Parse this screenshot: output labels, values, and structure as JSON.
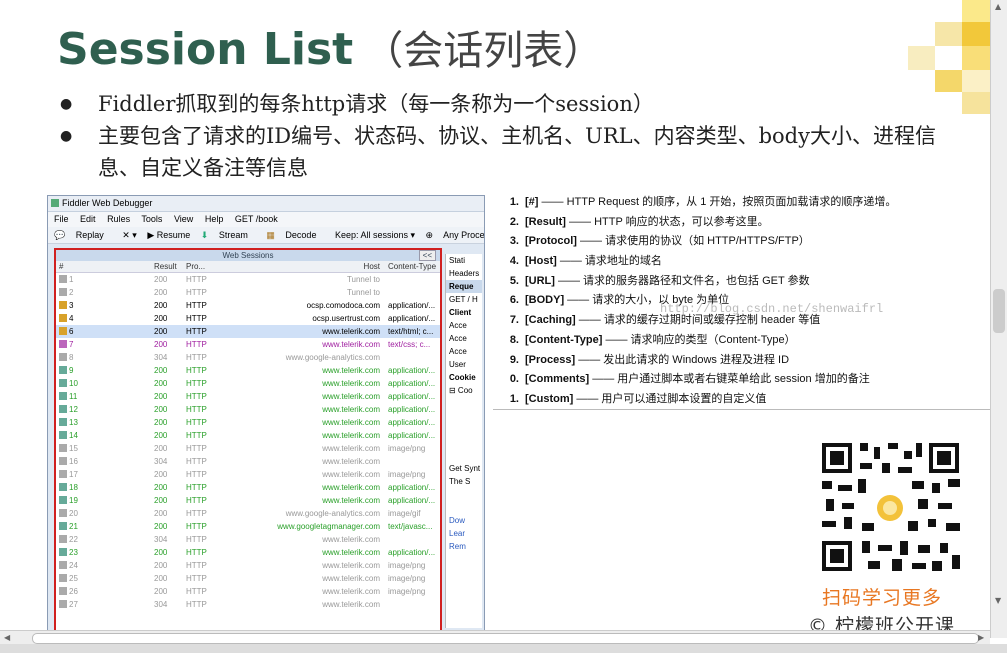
{
  "title": {
    "main": "Session List",
    "cn": "（会话列表）"
  },
  "bullets": [
    "Fiddler抓取到的每条http请求（每一条称为一个session）",
    "主要包含了请求的ID编号、状态码、协议、主机名、URL、内容类型、body大小、进程信息、自定义备注等信息"
  ],
  "fiddler": {
    "window_title": "Fiddler Web Debugger",
    "menu": [
      "File",
      "Edit",
      "Rules",
      "Tools",
      "View",
      "Help",
      "GET /book"
    ],
    "toolbar": [
      "Replay",
      "✕ ▾",
      "▶ Resume",
      "Stream",
      "Decode",
      "Keep: All sessions ▾",
      "Any Process"
    ],
    "panel_title": "Web Sessions",
    "collapse_label": "<<",
    "columns": {
      "num": "#",
      "result": "Result",
      "protocol": "Pro...",
      "host": "Host",
      "content_type": "Content-Type"
    },
    "rows": [
      {
        "num": "1",
        "result": "200",
        "protocol": "HTTP",
        "host": "Tunnel to",
        "ct": "",
        "color": "gr"
      },
      {
        "num": "2",
        "result": "200",
        "protocol": "HTTP",
        "host": "Tunnel to",
        "ct": "",
        "color": "gr"
      },
      {
        "num": "3",
        "result": "200",
        "protocol": "HTTP",
        "host": "ocsp.comodoca.com",
        "ct": "application/...",
        "color": "bk"
      },
      {
        "num": "4",
        "result": "200",
        "protocol": "HTTP",
        "host": "ocsp.usertrust.com",
        "ct": "application/...",
        "color": "bk"
      },
      {
        "num": "6",
        "result": "200",
        "protocol": "HTTP",
        "host": "www.telerik.com",
        "ct": "text/html; c...",
        "color": "bk"
      },
      {
        "num": "7",
        "result": "200",
        "protocol": "HTTP",
        "host": "www.telerik.com",
        "ct": "text/css; c...",
        "color": "p"
      },
      {
        "num": "8",
        "result": "304",
        "protocol": "HTTP",
        "host": "www.google-analytics.com",
        "ct": "",
        "color": "gr"
      },
      {
        "num": "9",
        "result": "200",
        "protocol": "HTTP",
        "host": "www.telerik.com",
        "ct": "application/...",
        "color": "g"
      },
      {
        "num": "10",
        "result": "200",
        "protocol": "HTTP",
        "host": "www.telerik.com",
        "ct": "application/...",
        "color": "g"
      },
      {
        "num": "11",
        "result": "200",
        "protocol": "HTTP",
        "host": "www.telerik.com",
        "ct": "application/...",
        "color": "g"
      },
      {
        "num": "12",
        "result": "200",
        "protocol": "HTTP",
        "host": "www.telerik.com",
        "ct": "application/...",
        "color": "g"
      },
      {
        "num": "13",
        "result": "200",
        "protocol": "HTTP",
        "host": "www.telerik.com",
        "ct": "application/...",
        "color": "g"
      },
      {
        "num": "14",
        "result": "200",
        "protocol": "HTTP",
        "host": "www.telerik.com",
        "ct": "application/...",
        "color": "g"
      },
      {
        "num": "15",
        "result": "200",
        "protocol": "HTTP",
        "host": "www.telerik.com",
        "ct": "image/png",
        "color": "gr"
      },
      {
        "num": "16",
        "result": "304",
        "protocol": "HTTP",
        "host": "www.telerik.com",
        "ct": "",
        "color": "gr"
      },
      {
        "num": "17",
        "result": "200",
        "protocol": "HTTP",
        "host": "www.telerik.com",
        "ct": "image/png",
        "color": "gr"
      },
      {
        "num": "18",
        "result": "200",
        "protocol": "HTTP",
        "host": "www.telerik.com",
        "ct": "application/...",
        "color": "g"
      },
      {
        "num": "19",
        "result": "200",
        "protocol": "HTTP",
        "host": "www.telerik.com",
        "ct": "application/...",
        "color": "g"
      },
      {
        "num": "20",
        "result": "200",
        "protocol": "HTTP",
        "host": "www.google-analytics.com",
        "ct": "image/gif",
        "color": "gr"
      },
      {
        "num": "21",
        "result": "200",
        "protocol": "HTTP",
        "host": "www.googletagmanager.com",
        "ct": "text/javasc...",
        "color": "g"
      },
      {
        "num": "22",
        "result": "304",
        "protocol": "HTTP",
        "host": "www.telerik.com",
        "ct": "",
        "color": "gr"
      },
      {
        "num": "23",
        "result": "200",
        "protocol": "HTTP",
        "host": "www.telerik.com",
        "ct": "application/...",
        "color": "g"
      },
      {
        "num": "24",
        "result": "200",
        "protocol": "HTTP",
        "host": "www.telerik.com",
        "ct": "image/png",
        "color": "gr"
      },
      {
        "num": "25",
        "result": "200",
        "protocol": "HTTP",
        "host": "www.telerik.com",
        "ct": "image/png",
        "color": "gr"
      },
      {
        "num": "26",
        "result": "200",
        "protocol": "HTTP",
        "host": "www.telerik.com",
        "ct": "image/png",
        "color": "gr"
      },
      {
        "num": "27",
        "result": "304",
        "protocol": "HTTP",
        "host": "www.telerik.com",
        "ct": "",
        "color": "gr"
      }
    ],
    "side_panel": [
      "Stati",
      "Headers",
      "Reque",
      "GET / H",
      "Client",
      "Acce",
      "Acce",
      "Acce",
      "User",
      "Cookie",
      "⊟ Coo",
      "",
      "",
      "",
      "",
      "",
      "Get Synt",
      "The S",
      "",
      "",
      "Dow",
      "Lear",
      "Rem"
    ]
  },
  "fields": [
    {
      "n": "1.",
      "key": "[#]",
      "desc": " —— HTTP Request 的顺序，从 1 开始，按照页面加载请求的顺序递增。"
    },
    {
      "n": "2.",
      "key": "[Result]",
      "desc": " —— HTTP 响应的状态，可以参考这里。"
    },
    {
      "n": "3.",
      "key": "[Protocol]",
      "desc": " —— 请求使用的协议（如 HTTP/HTTPS/FTP）"
    },
    {
      "n": "4.",
      "key": "[Host]",
      "desc": " —— 请求地址的域名"
    },
    {
      "n": "5.",
      "key": "[URL]",
      "desc": " —— 请求的服务器路径和文件名，也包括 GET 参数"
    },
    {
      "n": "6.",
      "key": "[BODY]",
      "desc": " —— 请求的大小，以 byte 为单位"
    },
    {
      "n": "7.",
      "key": "[Caching]",
      "desc": " —— 请求的缓存过期时间或缓存控制 header 等值"
    },
    {
      "n": "8.",
      "key": "[Content-Type]",
      "desc": " —— 请求响应的类型（Content-Type）"
    },
    {
      "n": "9.",
      "key": "[Process]",
      "desc": " —— 发出此请求的 Windows 进程及进程 ID"
    },
    {
      "n": "0.",
      "key": "[Comments]",
      "desc": " —— 用户通过脚本或者右键菜单给此 session 增加的备注"
    },
    {
      "n": "1.",
      "key": "[Custom]",
      "desc": " —— 用户可以通过脚本设置的自定义值"
    }
  ],
  "qr_caption": "扫码学习更多",
  "brand": "©  柠檬班公开课",
  "watermark": "http://blog.csdn.net/shenwaifrl"
}
